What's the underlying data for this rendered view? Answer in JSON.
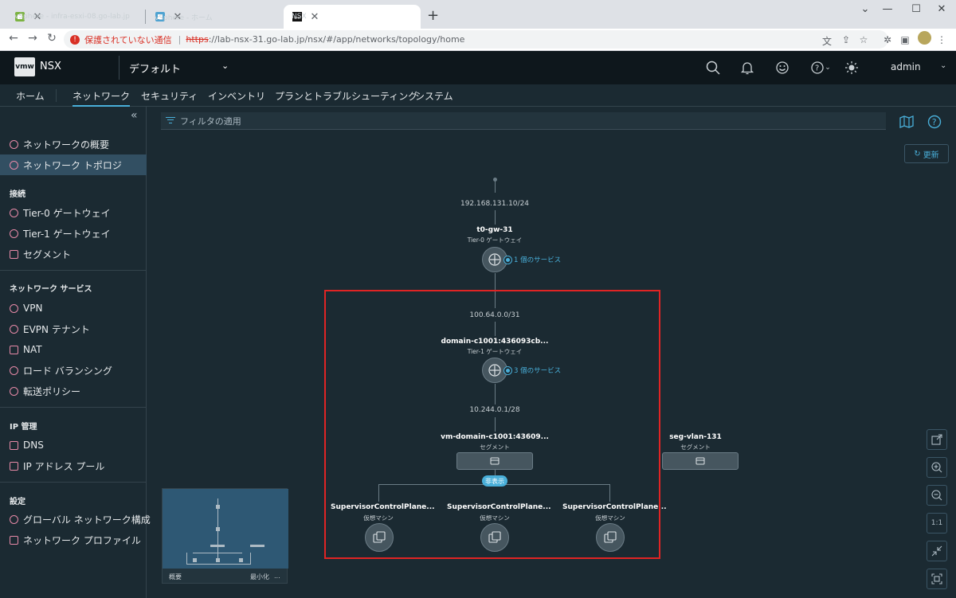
{
  "browser": {
    "tabs": [
      {
        "title": "vSphere - infra-esxi-08.go-lab.jp"
      },
      {
        "title": "vSphere - ホーム"
      },
      {
        "title": "NSX"
      }
    ],
    "security_label": "保護されていない通信",
    "url_scheme": "https",
    "url_rest": "://lab-nsx-31.go-lab.jp/nsx/#/app/networks/topology/home"
  },
  "header": {
    "logo": "vmw",
    "product": "NSX",
    "context": "デフォルト",
    "user": "admin"
  },
  "nav": {
    "tabs": [
      "ホーム",
      "ネットワーク",
      "セキュリティ",
      "インベントリ",
      "プランとトラブルシューティング",
      "システム"
    ],
    "active": "ネットワーク"
  },
  "sidebar": {
    "top_items": [
      "ネットワークの概要",
      "ネットワーク トポロジ"
    ],
    "sections": [
      {
        "heading": "接続",
        "items": [
          "Tier-0 ゲートウェイ",
          "Tier-1 ゲートウェイ",
          "セグメント"
        ]
      },
      {
        "heading": "ネットワーク サービス",
        "items": [
          "VPN",
          "EVPN テナント",
          "NAT",
          "ロード バランシング",
          "転送ポリシー"
        ]
      },
      {
        "heading": "IP 管理",
        "items": [
          "DNS",
          "IP アドレス プール"
        ]
      },
      {
        "heading": "設定",
        "items": [
          "グローバル ネットワーク構成",
          "ネットワーク プロファイル"
        ]
      }
    ]
  },
  "content": {
    "filter_placeholder": "フィルタの適用",
    "refresh": "更新",
    "topology": {
      "uplink_ip": "192.168.131.10/24",
      "t0": {
        "name": "t0-gw-31",
        "type": "Tier-0 ゲートウェイ",
        "services": "1 個のサービス"
      },
      "t0_t1_ip": "100.64.0.0/31",
      "t1": {
        "name": "domain-c1001:436093cb...",
        "type": "Tier-1 ゲートウェイ",
        "services": "3 個のサービス"
      },
      "t1_seg_ip": "10.244.0.1/28",
      "segment": {
        "name": "vm-domain-c1001:43609...",
        "type": "セグメント"
      },
      "segment2": {
        "name": "seg-vlan-131",
        "type": "セグメント"
      },
      "hide_label": "非表示",
      "vms": [
        {
          "name": "SupervisorControlPlane...",
          "type": "仮想マシン"
        },
        {
          "name": "SupervisorControlPlane...",
          "type": "仮想マシン"
        },
        {
          "name": "SupervisorControlPlane...",
          "type": "仮想マシン"
        }
      ]
    },
    "minimap": {
      "label": "概要",
      "minimize": "最小化",
      "more": "..."
    },
    "zoom_fit": "1:1"
  }
}
